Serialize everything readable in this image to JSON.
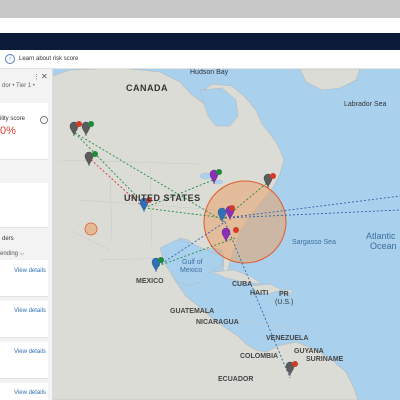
{
  "info_bar": {
    "text": "Learn about risk score",
    "icon": "info-icon"
  },
  "panel": {
    "breadcrumb": "dor • Tier 1 •",
    "menu": "⋮",
    "close": "✕",
    "score_label": "ility score",
    "score_value": "0%",
    "section_label": "ders",
    "sort_label": "ending ⌵",
    "view_links": [
      "View details",
      "View details",
      "View details",
      "View details"
    ]
  },
  "map": {
    "labels": {
      "hudson_bay": "Hudson Bay",
      "canada": "CANADA",
      "labrador_sea": "Labrador Sea",
      "united_states": "UNITED STATES",
      "sargasso_sea": "Sargasso Sea",
      "atlantic": "Atlantic",
      "ocean": "Ocean",
      "gulf_of": "Gulf of",
      "mexico_gulf": "Mexico",
      "mexico": "MEXICO",
      "cuba": "CUBA",
      "haiti": "HAITI",
      "pr": "PR",
      "us": "(U.S.)",
      "guatemala": "GUATEMALA",
      "nicaragua": "NICARAGUA",
      "venezuela": "VENEZUELA",
      "colombia": "COLOMBIA",
      "guyana": "GUYANA",
      "suriname": "SURINAME",
      "ecuador": "ECUADOR"
    }
  }
}
